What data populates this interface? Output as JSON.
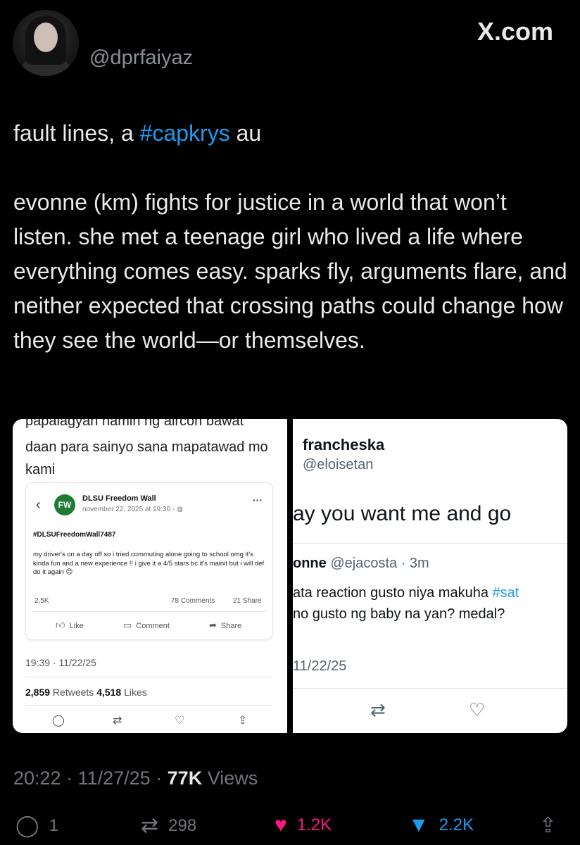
{
  "header": {
    "handle": "@dprfaiyaz",
    "brand": "X.com"
  },
  "tweet": {
    "line1_prefix": "fault lines, a ",
    "line1_hashtag": "#capkrys",
    "line1_suffix": " au",
    "paragraph2": "evonne (km) fights for justice in a world that won’t listen. she met a teenage girl who lived a life where everything comes easy. sparks fly, arguments flare, and neither expected that crossing paths could change how they see the world—or themselves."
  },
  "media_left": {
    "cut_top": "papalagyan namin ng aircon bawat",
    "text": "daan para sainyo sana mapatawad mo kami",
    "fb_post": {
      "page_name": "DLSU Freedom Wall",
      "logo": "FW",
      "date": "november 22, 2025 at 19:30 · ",
      "tag": "#DLSUFreedomWall7487",
      "body": "my driver's on a day off so i tried commuting alone going to school omg it's kinda fun and a new experience !! i give it a 4/5 stars bc it's mainit but i will def do it again 😊",
      "likes": "2.5K",
      "comments": "78 Comments",
      "shares": "21 Share",
      "like_label": "Like",
      "comment_label": "Comment",
      "share_label": "Share"
    },
    "time": "19:39 · 11/22/25",
    "retweets_count": "2,859",
    "retweets_label": " Retweets ",
    "likes_count": "4,518",
    "likes_label": " Likes"
  },
  "media_right": {
    "name": "francheska",
    "handle": "@eloisetan",
    "big_text": "ay you want me and go",
    "quoted_name": "onne",
    "quoted_handle": " @ejacosta · 3m",
    "quoted_line1_prefix": "ata reaction gusto niya makuha ",
    "quoted_line1_hashtag": "#sat",
    "quoted_line2": "no gusto ng baby na yan? medal?",
    "date": "11/22/25"
  },
  "meta": {
    "time": "20:22 · 11/27/25 · ",
    "views_count": "77K",
    "views_label": " Views"
  },
  "actions": {
    "replies": "1",
    "retweets": "298",
    "likes": "1.2K",
    "bookmarks": "2.2K"
  },
  "colors": {
    "background": "#000000",
    "hashtag": "#1d9bf0",
    "like": "#f91880",
    "bookmark": "#1d9bf0",
    "muted": "#71767b"
  }
}
